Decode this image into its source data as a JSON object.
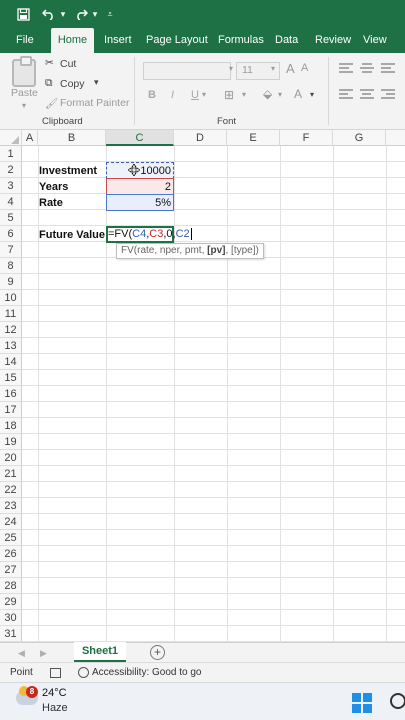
{
  "ribbon_tabs": [
    "File",
    "Home",
    "Insert",
    "Page Layout",
    "Formulas",
    "Data",
    "Review",
    "View"
  ],
  "clipboard": {
    "paste_label": "Paste",
    "cut_label": "Cut",
    "copy_label": "Copy",
    "format_painter_label": "Format Painter",
    "group_label": "Clipboard"
  },
  "font": {
    "size_value": "11",
    "group_label": "Font",
    "bold": "B",
    "italic": "I",
    "underline": "U"
  },
  "columns": [
    "A",
    "B",
    "C",
    "D",
    "E",
    "F",
    "G"
  ],
  "selected_column": "C",
  "rows": [
    "1",
    "2",
    "3",
    "4",
    "5",
    "6",
    "7",
    "8",
    "9",
    "10",
    "11",
    "12",
    "13",
    "14",
    "15",
    "16",
    "17",
    "18",
    "19",
    "20",
    "21",
    "22",
    "23",
    "24",
    "25",
    "26",
    "27",
    "28",
    "29",
    "30",
    "31"
  ],
  "cells": {
    "b2": "Investment",
    "c2": "10000",
    "b3": "Years",
    "c3": "2",
    "b4": "Rate",
    "c4": "5%",
    "b6": "Future Value"
  },
  "formula": {
    "prefix": "=FV(",
    "ref1": "C4",
    "sep1": ",",
    "ref2": "C3",
    "sep2": ",0,",
    "ref3": "C2"
  },
  "tooltip": {
    "before": "FV(rate, nper, pmt, ",
    "bold": "[pv]",
    "after": ", [type])"
  },
  "sheet_tab": "Sheet1",
  "add_sheet": "+",
  "status": {
    "mode": "Point",
    "accessibility": "Accessibility: Good to go"
  },
  "taskbar": {
    "badge": "8",
    "temperature": "24°C",
    "condition": "Haze"
  },
  "colors": {
    "excel_green": "#1e7145",
    "ref_blue": "#3a5fb0",
    "ref_red": "#c62828"
  }
}
